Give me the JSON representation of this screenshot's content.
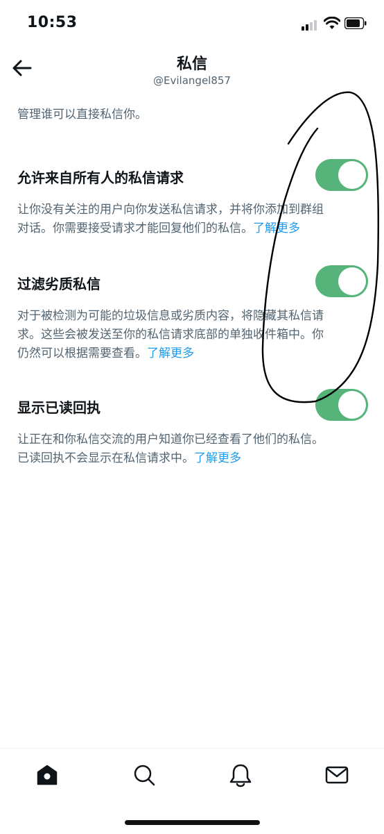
{
  "status_bar": {
    "time": "10:53"
  },
  "header": {
    "title": "私信",
    "handle": "@Evilangel857"
  },
  "intro": "管理谁可以直接私信你。",
  "settings": [
    {
      "title": "允许来自所有人的私信请求",
      "desc_lines": [
        "让你没有关注的用户向你发送私信请求，并将你添加到群组",
        "对话。你需要接受请求才能回复他们的私信。"
      ],
      "link": "了解更多",
      "enabled": true
    },
    {
      "title": "过滤劣质私信",
      "desc_lines": [
        "对于被检测为可能的垃圾信息或劣质内容，将隐藏其私信请",
        "求。这些会被发送至你的私信请求底部的单独收件箱中。你",
        "仍然可以根据需要查看。"
      ],
      "link": "了解更多",
      "enabled": true
    },
    {
      "title": "显示已读回执",
      "desc_lines": [
        "让正在和你私信交流的用户知道你已经查看了他们的私信。",
        "已读回执不会显示在私信请求中。"
      ],
      "link": "了解更多",
      "enabled": true
    }
  ],
  "bottom_nav": [
    "home-icon",
    "search-icon",
    "notifications-bell-icon",
    "messages-envelope-icon"
  ],
  "colors": {
    "toggle_on": "#56b47a",
    "link": "#1d9bf0",
    "secondary_text": "#536471",
    "primary_text": "#0f1419"
  }
}
